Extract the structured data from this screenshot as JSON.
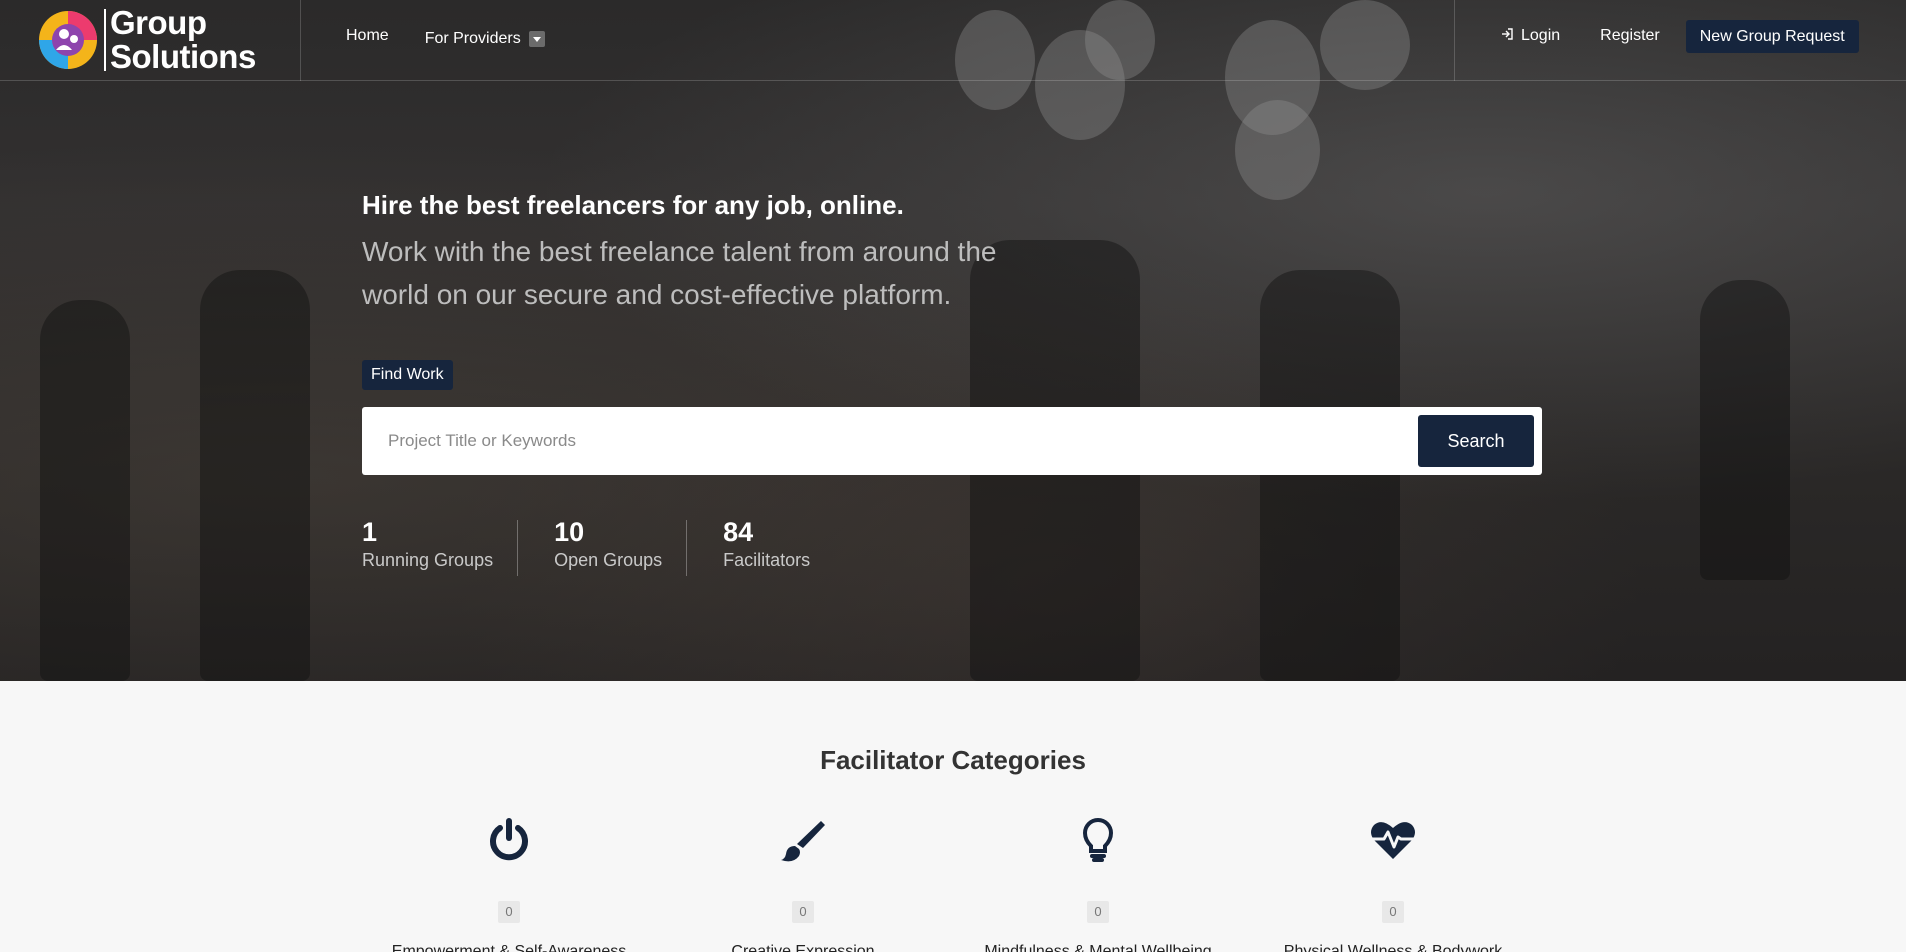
{
  "brand": {
    "line1": "Group",
    "line2": "Solutions"
  },
  "nav": {
    "home": "Home",
    "providers": "For Providers",
    "login": "Login",
    "register": "Register",
    "new_group_request": "New Group Request"
  },
  "hero": {
    "headline": "Hire the best freelancers for any job, online.",
    "subline": "Work with the best freelance talent from around the world on our secure and cost-effective platform.",
    "find_work": "Find Work",
    "search_placeholder": "Project Title or Keywords",
    "search_button": "Search"
  },
  "stats": [
    {
      "value": "1",
      "label": "Running Groups"
    },
    {
      "value": "10",
      "label": "Open Groups"
    },
    {
      "value": "84",
      "label": "Facilitators"
    }
  ],
  "categories": {
    "title": "Facilitator Categories",
    "items": [
      {
        "icon": "power-icon",
        "count": "0",
        "name": "Empowerment & Self-Awareness"
      },
      {
        "icon": "paintbrush-icon",
        "count": "0",
        "name": "Creative Expression"
      },
      {
        "icon": "lightbulb-icon",
        "count": "0",
        "name": "Mindfulness & Mental Wellbeing"
      },
      {
        "icon": "heartbeat-icon",
        "count": "0",
        "name": "Physical Wellness & Bodywork"
      }
    ]
  },
  "colors": {
    "primary": "#16253d",
    "icon": "#16253d",
    "page_bg": "#f7f7f7"
  }
}
